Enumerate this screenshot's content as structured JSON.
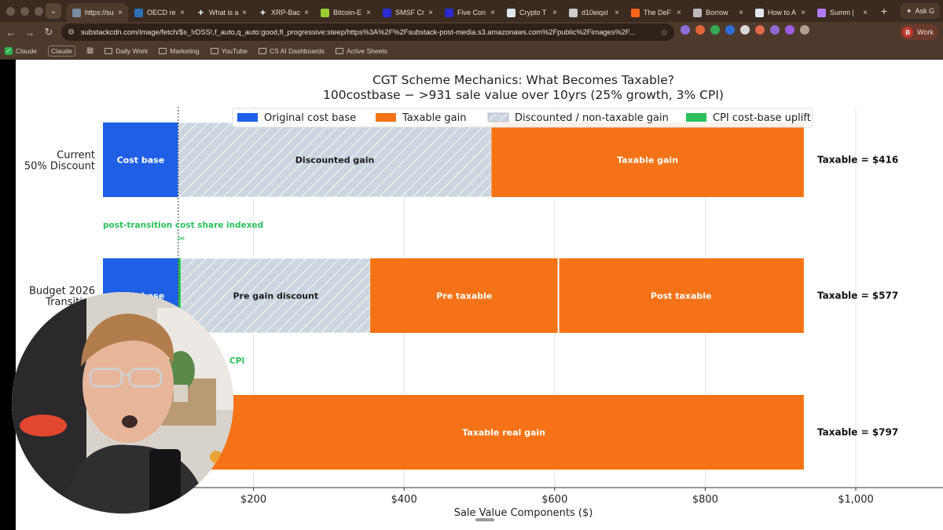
{
  "browser": {
    "tabs": [
      {
        "title": "https://su",
        "icon": "page-icon",
        "color": "#7a8aa0",
        "active": true
      },
      {
        "title": "OECD re",
        "icon": "oecd-icon",
        "color": "#2c6fb6"
      },
      {
        "title": "What is a",
        "icon": "plus-icon",
        "color": "#ffffff"
      },
      {
        "title": "XRP-Bac",
        "icon": "plus-icon",
        "color": "#ffffff"
      },
      {
        "title": "Bitcoin-E",
        "icon": "bitcoin-icon",
        "color": "#9acd32"
      },
      {
        "title": "SMSF Cr",
        "icon": "smsf-icon",
        "color": "#2a2ad0"
      },
      {
        "title": "Five Con",
        "icon": "five-icon",
        "color": "#2a2ad0"
      },
      {
        "title": "Crypto T",
        "icon": "k-icon",
        "color": "#dfe6ee"
      },
      {
        "title": "d10eiqxl",
        "icon": "github-icon",
        "color": "#cccccc"
      },
      {
        "title": "The DeF",
        "icon": "substack-icon",
        "color": "#ff6719"
      },
      {
        "title": "Borrow",
        "icon": "arc-icon",
        "color": "#bbbbbb"
      },
      {
        "title": "How to A",
        "icon": "k-icon",
        "color": "#dfe6ee"
      },
      {
        "title": "Summ | ",
        "icon": "summ-icon",
        "color": "#b07cff"
      }
    ],
    "ask_label": "Ask G",
    "url": "substackcdn.com/image/fetch/$s_!rDSS!,f_auto,q_auto:good,fl_progressive:steep/https%3A%2F%2Fsubstack-post-media.s3.amazonaws.com%2Fpublic%2Fimages%2F...",
    "profile_initial": "B",
    "profile_label": "Work",
    "bookmarks": [
      {
        "label": "Claude",
        "type": "check"
      },
      {
        "label": "Claude",
        "type": "pill"
      },
      {
        "label": "",
        "type": "grid"
      },
      {
        "label": "Daily Work",
        "type": "folder"
      },
      {
        "label": "Marketing",
        "type": "folder"
      },
      {
        "label": "YouTube",
        "type": "folder"
      },
      {
        "label": "CS AI Dashboards",
        "type": "folder"
      },
      {
        "label": "Active Sheets",
        "type": "folder"
      }
    ],
    "extension_colors": [
      "#8a6fd8",
      "#e0663a",
      "#35a853",
      "#2b6fd6",
      "#d8d8d8",
      "#e06a4a",
      "#8f6ad0",
      "#9b5de5",
      "#b0a090"
    ]
  },
  "chart_data": {
    "type": "bar",
    "orientation": "horizontal-stacked",
    "title": "CGT Scheme Mechanics: What Becomes Taxable?",
    "subtitle": "100costbase − >931 sale value over 10yrs (25% growth, 3% CPI)",
    "xlabel": "Sale Value Components ($)",
    "xlim": [
      0,
      1100
    ],
    "xticks": [
      "$200",
      "$400",
      "$600",
      "$800",
      "$1,000"
    ],
    "xtick_values": [
      200,
      400,
      600,
      800,
      1000
    ],
    "grid": "vertical",
    "legend_position": "top-center",
    "legend": [
      {
        "label": "Original cost base",
        "color": "#1f5fe6",
        "style": "solid"
      },
      {
        "label": "Taxable gain",
        "color": "#f57316",
        "style": "solid"
      },
      {
        "label": "Discounted / non-taxable gain",
        "color": "#c9d2de",
        "style": "hatched"
      },
      {
        "label": "CPI cost-base uplift",
        "color": "#2cc05a",
        "style": "solid"
      }
    ],
    "cost_base_marker": 100,
    "rows": [
      {
        "label_lines": [
          "Current",
          "50% Discount"
        ],
        "taxable_label": "Taxable = $416",
        "segments": [
          {
            "label": "Cost base",
            "start": 0,
            "end": 100,
            "kind": "cost"
          },
          {
            "label": "Discounted gain",
            "start": 100,
            "end": 516,
            "kind": "discount"
          },
          {
            "label": "Taxable gain",
            "start": 516,
            "end": 931,
            "kind": "taxable"
          }
        ]
      },
      {
        "label_lines": [
          "Budget 2026",
          "Transition"
        ],
        "taxable_label": "Taxable = $577",
        "annotation": "post-transition cost share indexed",
        "segments": [
          {
            "label": "Cost base",
            "start": 0,
            "end": 100,
            "kind": "cost"
          },
          {
            "label": "",
            "start": 100,
            "end": 104,
            "kind": "cpi"
          },
          {
            "label": "Pre gain discount",
            "start": 104,
            "end": 355,
            "kind": "discount"
          },
          {
            "label": "Pre taxable",
            "start": 355,
            "end": 605,
            "kind": "taxable"
          },
          {
            "label": "Post taxable",
            "start": 605,
            "end": 931,
            "kind": "taxable"
          }
        ]
      },
      {
        "label_lines": [
          "",
          ""
        ],
        "taxable_label": "Taxable = $797",
        "annotation": "CPI",
        "segments": [
          {
            "label": "",
            "start": 0,
            "end": 100,
            "kind": "cost"
          },
          {
            "label": "",
            "start": 100,
            "end": 134,
            "kind": "cpi"
          },
          {
            "label": "Taxable real gain",
            "start": 134,
            "end": 931,
            "kind": "taxable"
          }
        ]
      }
    ]
  }
}
